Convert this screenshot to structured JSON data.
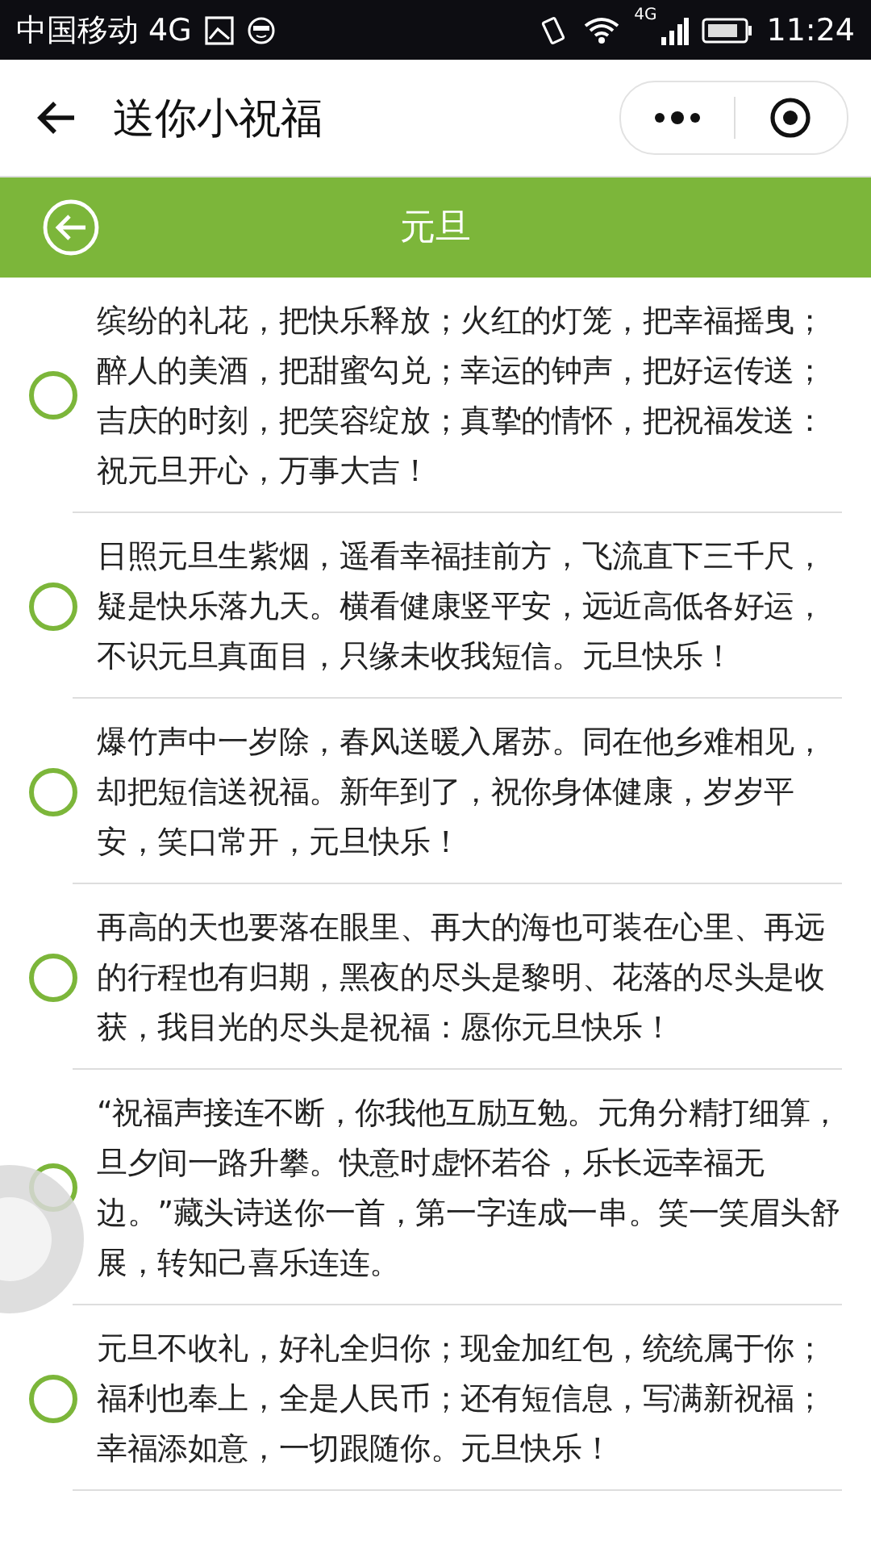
{
  "status_bar": {
    "carrier": "中国移动 4G",
    "network": "4G",
    "time": "11:24"
  },
  "nav": {
    "title": "送你小祝福"
  },
  "header": {
    "title": "元旦"
  },
  "messages": [
    {
      "text": "缤纷的礼花，把快乐释放；火红的灯笼，把幸福摇曳；醉人的美酒，把甜蜜勾兑；幸运的钟声，把好运传送；吉庆的时刻，把笑容绽放；真挚的情怀，把祝福发送：祝元旦开心，万事大吉！",
      "selected": false
    },
    {
      "text": "日照元旦生紫烟，遥看幸福挂前方，飞流直下三千尺，疑是快乐落九天。横看健康竖平安，远近高低各好运，不识元旦真面目，只缘未收我短信。元旦快乐！",
      "selected": false
    },
    {
      "text": "爆竹声中一岁除，春风送暖入屠苏。同在他乡难相见，却把短信送祝福。新年到了，祝你身体健康，岁岁平安，笑口常开，元旦快乐！",
      "selected": false
    },
    {
      "text": "再高的天也要落在眼里、再大的海也可装在心里、再远的行程也有归期，黑夜的尽头是黎明、花落的尽头是收获，我目光的尽头是祝福：愿你元旦快乐！",
      "selected": false
    },
    {
      "text": "“祝福声接连不断，你我他互励互勉。元角分精打细算，旦夕间一路升攀。快意时虚怀若谷，乐长远幸福无边。”藏头诗送你一首，第一字连成一串。笑一笑眉头舒展，转知己喜乐连连。",
      "selected": false
    },
    {
      "text": "元旦不收礼，好礼全归你；现金加红包，统统属于你；福利也奉上，全是人民币；还有短信息，写满新祝福；幸福添如意，一切跟随你。元旦快乐！",
      "selected": false
    }
  ]
}
